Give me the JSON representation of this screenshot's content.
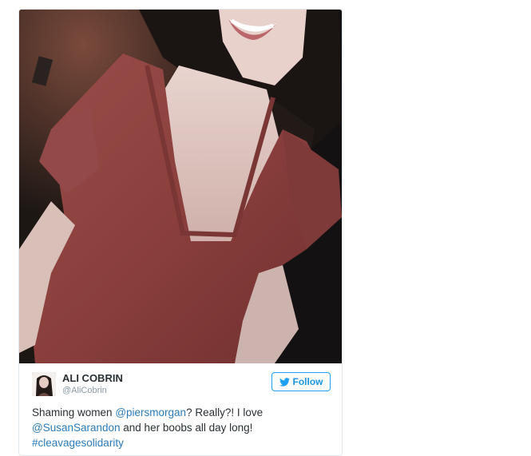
{
  "tweet": {
    "author_name": "ALI COBRIN",
    "author_handle": "@AliCobrin",
    "follow_label": "Follow",
    "text_part1": "Shaming women ",
    "mention1": "@piersmorgan",
    "text_part2": "? Really?! I love ",
    "mention2": "@SusanSarandon",
    "text_part3": " and her boobs all day long! ",
    "hashtag": "#cleavagesolidarity"
  },
  "colors": {
    "link": "#2b7bb9",
    "follow_border": "#1da1f2",
    "text": "#292f33",
    "muted": "#8899a6"
  },
  "icons": {
    "follow": "twitter-bird-icon"
  }
}
